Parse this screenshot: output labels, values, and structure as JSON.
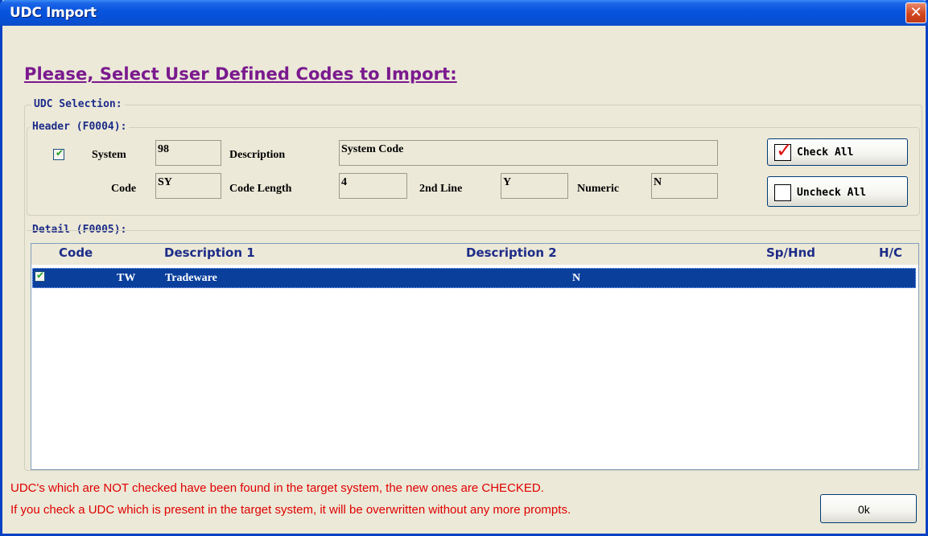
{
  "window": {
    "title": "UDC Import",
    "close_symbol": "✕"
  },
  "heading": "Please, Select User Defined Codes to Import:",
  "udc_selection": {
    "legend": "UDC Selection:"
  },
  "header": {
    "legend": "Header (F0004):",
    "checked": true,
    "system_label": "System",
    "system_value": "98",
    "description_label": "Description",
    "description_value": "System Code",
    "code_label": "Code",
    "code_value": "SY",
    "code_length_label": "Code Length",
    "code_length_value": "4",
    "second_line_label": "2nd Line",
    "second_line_value": "Y",
    "numeric_label": "Numeric",
    "numeric_value": "N"
  },
  "buttons": {
    "check_all": "Check All",
    "uncheck_all": "Uncheck All",
    "ok": "0k"
  },
  "detail": {
    "legend": "Detail (F0005):",
    "columns": [
      "Code",
      "Description 1",
      "Description 2",
      "Sp/Hnd",
      "H/C"
    ],
    "rows": [
      {
        "checked": true,
        "code": "TW",
        "description1": "Tradeware",
        "description2": "N",
        "sp_hnd": "",
        "hc": ""
      }
    ]
  },
  "messages": {
    "line1": "UDC's which are NOT checked have been found in the target system, the new ones are CHECKED.",
    "line2": "If you check a UDC which is present in the target system, it will be overwritten without any more prompts."
  },
  "colors": {
    "title_bar": "#0a55df",
    "heading": "#7a1a8e",
    "selection": "#0a3f9c",
    "warning": "#e00000"
  }
}
